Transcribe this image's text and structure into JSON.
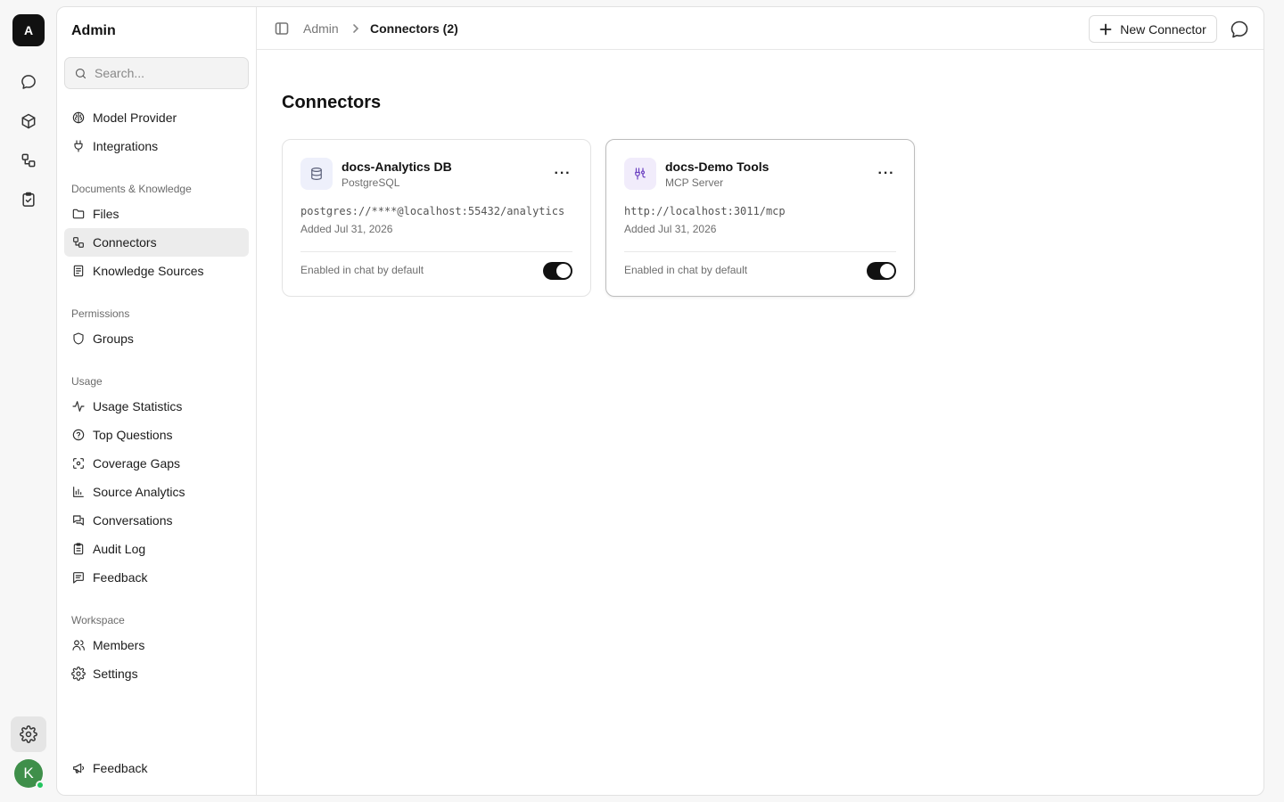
{
  "rail": {
    "logo_letter": "A",
    "avatar_letter": "K",
    "icons": [
      "chat-icon",
      "cube-icon",
      "connectors-icon",
      "clipboard-check-icon",
      "gear-icon"
    ]
  },
  "sidebar": {
    "title": "Admin",
    "search_placeholder": "Search...",
    "top_items": [
      {
        "label": "Model Provider",
        "icon": "brain-icon"
      },
      {
        "label": "Integrations",
        "icon": "plug-icon"
      }
    ],
    "sections": [
      {
        "title": "Documents & Knowledge",
        "items": [
          {
            "label": "Files",
            "icon": "folder-icon"
          },
          {
            "label": "Connectors",
            "icon": "connectors-icon",
            "active": true
          },
          {
            "label": "Knowledge Sources",
            "icon": "book-icon"
          }
        ]
      },
      {
        "title": "Permissions",
        "items": [
          {
            "label": "Groups",
            "icon": "shield-icon"
          }
        ]
      },
      {
        "title": "Usage",
        "items": [
          {
            "label": "Usage Statistics",
            "icon": "activity-icon"
          },
          {
            "label": "Top Questions",
            "icon": "help-circle-icon"
          },
          {
            "label": "Coverage Gaps",
            "icon": "scan-icon"
          },
          {
            "label": "Source Analytics",
            "icon": "bar-chart-icon"
          },
          {
            "label": "Conversations",
            "icon": "messages-icon"
          },
          {
            "label": "Audit Log",
            "icon": "clipboard-list-icon"
          },
          {
            "label": "Feedback",
            "icon": "message-square-text-icon"
          }
        ]
      },
      {
        "title": "Workspace",
        "items": [
          {
            "label": "Members",
            "icon": "users-icon"
          },
          {
            "label": "Settings",
            "icon": "gear-icon"
          }
        ]
      }
    ],
    "footer_item": {
      "label": "Feedback",
      "icon": "megaphone-icon"
    }
  },
  "topbar": {
    "breadcrumb_root": "Admin",
    "breadcrumb_current": "Connectors (2)",
    "new_button_label": "New Connector"
  },
  "page": {
    "title": "Connectors"
  },
  "connectors": [
    {
      "name": "docs-Analytics DB",
      "type": "PostgreSQL",
      "url": "postgres://****@localhost:55432/analytics",
      "added": "Added Jul 31, 2026",
      "footer_label": "Enabled in chat by default",
      "enabled": true,
      "icon": "database-icon",
      "icon_bg": "#eef0fb",
      "icon_color": "#5b6079"
    },
    {
      "name": "docs-Demo Tools",
      "type": "MCP Server",
      "url": "http://localhost:3011/mcp",
      "added": "Added Jul 31, 2026",
      "footer_label": "Enabled in chat by default",
      "enabled": true,
      "icon": "mcp-icon",
      "icon_bg": "#f1ecfb",
      "icon_color": "#6a3fc0"
    }
  ]
}
